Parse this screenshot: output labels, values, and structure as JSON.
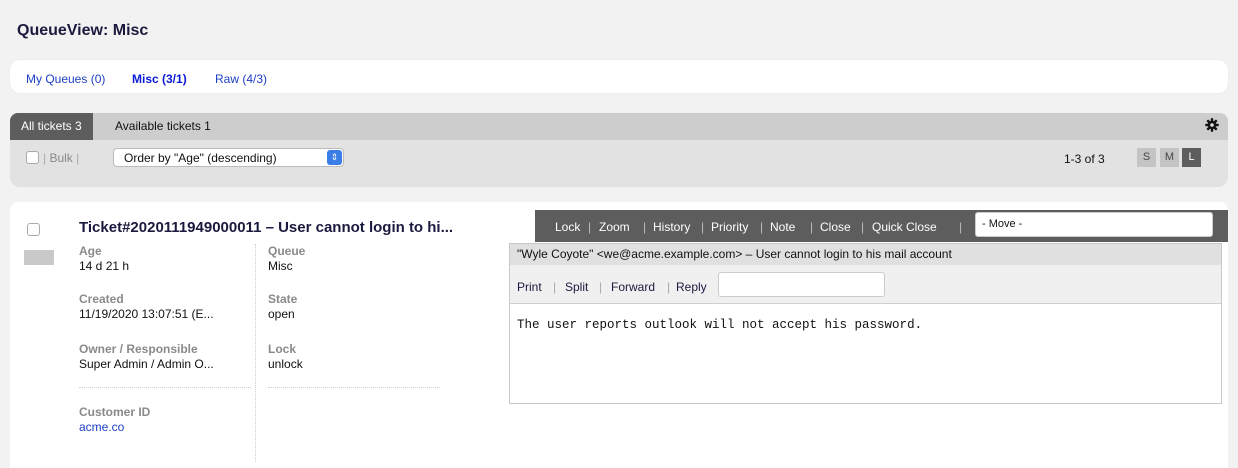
{
  "page": {
    "title": "QueueView: Misc"
  },
  "queues": [
    {
      "label": "My Queues (0)"
    },
    {
      "label": "Misc (3/1)"
    },
    {
      "label": "Raw (4/3)"
    }
  ],
  "tabs": {
    "all": "All tickets 3",
    "available": "Available tickets 1"
  },
  "toolbar": {
    "bulk": "Bulk",
    "order_by": "Order by \"Age\" (descending)",
    "pager": "1-3 of 3",
    "sizes": [
      "S",
      "M",
      "L"
    ],
    "selected_size": "L"
  },
  "ticket": {
    "title": "Ticket#2020111949000011 – User cannot login to hi...",
    "fields": {
      "age_label": "Age",
      "age": "14 d 21 h",
      "created_label": "Created",
      "created": "11/19/2020 13:07:51 (E...",
      "owner_label": "Owner / Responsible",
      "owner": "Super Admin / Admin O...",
      "customer_label": "Customer ID",
      "customer": "acme.co",
      "queue_label": "Queue",
      "queue": "Misc",
      "state_label": "State",
      "state": "open",
      "lock_label": "Lock",
      "lock": "unlock"
    },
    "actions": [
      "Lock",
      "Zoom",
      "History",
      "Priority",
      "Note",
      "Close",
      "Quick Close"
    ],
    "move_placeholder": "- Move -",
    "article": {
      "header": "\"Wyle Coyote\" <we@acme.example.com> – User cannot login to his mail account",
      "tools": [
        "Print",
        "Split",
        "Forward",
        "Reply"
      ],
      "body": "The user reports outlook will not accept his password."
    }
  },
  "colors": {
    "link": "#1d3fc6",
    "active_tab": "#5d5d5d",
    "select_arrow": "#3a7de6"
  }
}
